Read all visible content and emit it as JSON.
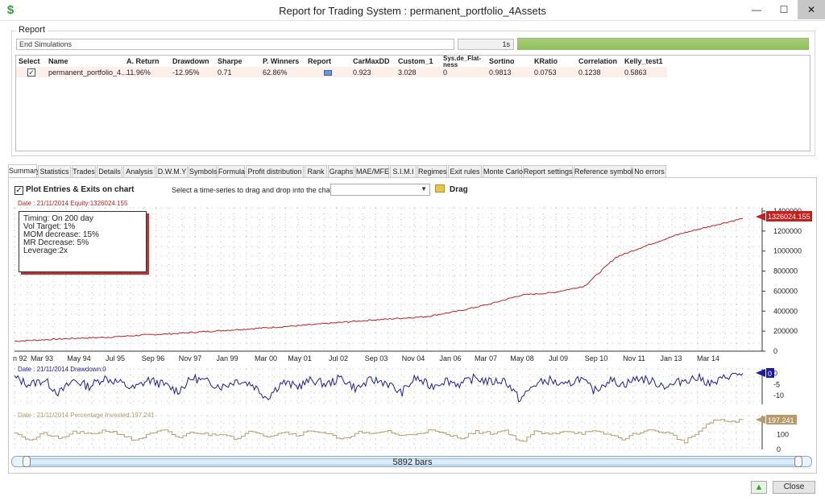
{
  "window": {
    "title": "Report for Trading System : permanent_portfolio_4Assets",
    "minimize": "—",
    "maximize": "☐",
    "close": "✕"
  },
  "report": {
    "group_label": "Report",
    "status_text": "End Simulations",
    "elapsed": "1s",
    "progress_pct": 100,
    "columns": [
      "Select",
      "Name",
      "A. Return",
      "Drawdown",
      "Sharpe",
      "P. Winners",
      "Report",
      "CarMaxDD",
      "Custom_1",
      "Sys.de_Flat­ness",
      "Sortino",
      "KRatio",
      "Correlation",
      "Kelly_test1"
    ],
    "row": {
      "selected": true,
      "name": "permanent_portfolio_4...",
      "a_return": "11.96%",
      "drawdown": "-12.95%",
      "sharpe": "0.71",
      "p_winners": "62.86%",
      "carmaxdd": "0.923",
      "custom_1": "3.028",
      "flatness": "0",
      "sortino": "0.9813",
      "kratio": "0.0753",
      "correlation": "0.1238",
      "kelly": "0.5863"
    }
  },
  "tabs": [
    "Summary",
    "Statistics",
    "Trades",
    "Details",
    "Analysis",
    "D.W.M.Y",
    "Symbols",
    "Formula",
    "Profit distribution",
    "Rank",
    "Graphs",
    "MAE/MFE",
    "S.I.M.I",
    "Regimes",
    "Exit rules",
    "Monte Carlo",
    "Report settings",
    "Reference symbol",
    "No errors"
  ],
  "active_tab": "Summary",
  "toolbar": {
    "plot_label": "Plot Entries & Exits on chart",
    "plot_checked": true,
    "select_label": "Select a time-series to drag and drop into the chart :",
    "combo_value": "",
    "drag_label": "Drag"
  },
  "info_box": {
    "lines": [
      "Timing: On 200 day",
      "Vol Target: 1%",
      "MOM decrease: 15%",
      "MR Decrease: 5%",
      "Leverage:2x"
    ]
  },
  "colors": {
    "equity": "#c81e1e",
    "drawdown": "#1a1aa6",
    "invested": "#b89a6a"
  },
  "chart_data": [
    {
      "type": "line",
      "header": "Date : 21/11/2014   Equity:1326024.155",
      "last_value_label": "1326024.155",
      "x_tick_labels": [
        "n 92",
        "Mar 93",
        "May 94",
        "Jul 95",
        "Sep 96",
        "Nov 97",
        "Jan 99",
        "Mar 00",
        "May 01",
        "Jul 02",
        "Sep 03",
        "Nov 04",
        "Jan 06",
        "Mar 07",
        "May 08",
        "Jul 09",
        "Sep 10",
        "Nov 11",
        "Jan 13",
        "Mar 14"
      ],
      "y_ticks": [
        0,
        200000,
        400000,
        600000,
        800000,
        1000000,
        1200000,
        1400000
      ],
      "ylim": [
        0,
        1400000
      ],
      "x": [
        1992.0,
        1993.0,
        1994.0,
        1995.0,
        1996.0,
        1997.0,
        1998.0,
        1999.0,
        2000.0,
        2001.0,
        2002.0,
        2003.0,
        2004.0,
        2005.0,
        2006.0,
        2007.0,
        2008.0,
        2009.0,
        2010.0,
        2011.0,
        2012.0,
        2013.0,
        2014.0,
        2014.9
      ],
      "series": [
        {
          "values": [
            100000,
            115000,
            130000,
            140000,
            160000,
            175000,
            195000,
            215000,
            235000,
            255000,
            280000,
            305000,
            325000,
            345000,
            400000,
            470000,
            560000,
            585000,
            650000,
            940000,
            1060000,
            1170000,
            1250000,
            1326024
          ]
        }
      ]
    },
    {
      "type": "line",
      "header": "Date : 21/11/2014   Drawdown:0",
      "last_value_label": "0",
      "y_ticks": [
        0,
        -5,
        -10
      ],
      "ylim": [
        -14,
        2
      ],
      "series": [
        {
          "values": [
            -2,
            -5,
            -3,
            -9,
            -3,
            -6,
            -2,
            -4,
            -7,
            -3,
            -5,
            -8,
            -2,
            -4,
            -6,
            -3,
            -5,
            -11,
            -4,
            -6,
            -3,
            -5,
            -2,
            -7,
            -3,
            -4,
            -9,
            -2,
            -6,
            -3,
            -5,
            -2,
            -4,
            -3,
            -12,
            -5,
            -3,
            -6,
            -2,
            -8,
            -3,
            -5,
            -2,
            -4,
            -6,
            -3,
            -2,
            -5,
            -1,
            0
          ]
        }
      ]
    },
    {
      "type": "line",
      "header": "Date : 21/11/2014   Percentage Invested:197.241",
      "last_value_label": "197.241",
      "y_ticks": [
        0,
        100
      ],
      "ylim": [
        0,
        230
      ],
      "series": [
        {
          "values": [
            120,
            60,
            110,
            70,
            120,
            100,
            130,
            110,
            60,
            100,
            130,
            80,
            120,
            100,
            110,
            70,
            130,
            90,
            120,
            100,
            130,
            110,
            60,
            120,
            100,
            130,
            90,
            110,
            130,
            100,
            80,
            120,
            110,
            130,
            50,
            120,
            100,
            130,
            110,
            120,
            100,
            70,
            120,
            130,
            110,
            50,
            120,
            200,
            190,
            197
          ]
        }
      ]
    }
  ],
  "scroller": {
    "label": "5892 bars"
  },
  "buttons": {
    "close": "Close"
  }
}
